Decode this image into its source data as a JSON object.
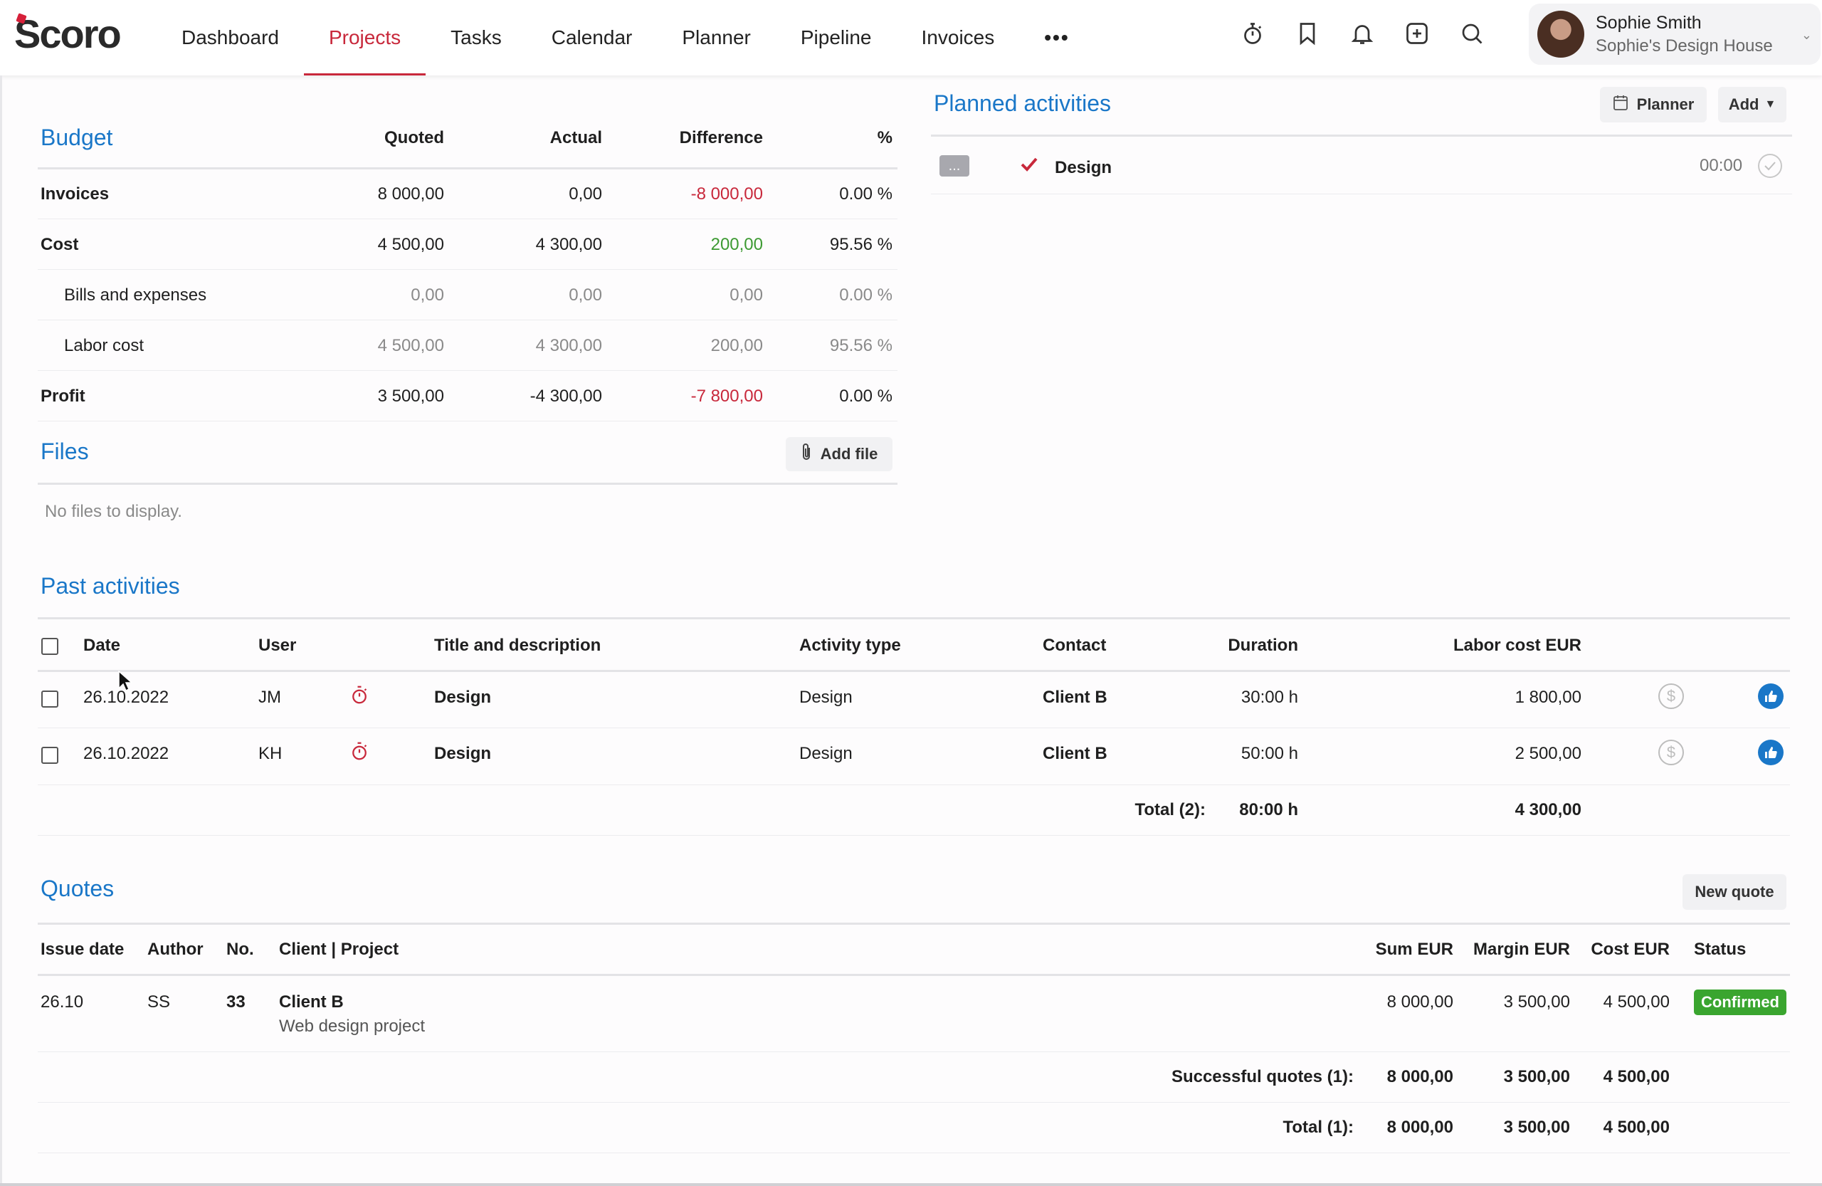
{
  "app": {
    "logo": "Scoro"
  },
  "nav": {
    "items": [
      "Dashboard",
      "Projects",
      "Tasks",
      "Calendar",
      "Planner",
      "Pipeline",
      "Invoices"
    ],
    "more": "•••"
  },
  "user": {
    "name": "Sophie Smith",
    "org": "Sophie's Design House"
  },
  "budget": {
    "title": "Budget",
    "headers": [
      "Quoted",
      "Actual",
      "Difference",
      "%"
    ],
    "rows": [
      {
        "label": "Invoices",
        "quoted": "8 000,00",
        "actual": "0,00",
        "difference": "-8 000,00",
        "pct": "0.00 %"
      },
      {
        "label": "Cost",
        "quoted": "4 500,00",
        "actual": "4 300,00",
        "difference": "200,00",
        "pct": "95.56 %"
      },
      {
        "label": "Bills and expenses",
        "quoted": "0,00",
        "actual": "0,00",
        "difference": "0,00",
        "pct": "0.00 %"
      },
      {
        "label": "Labor cost",
        "quoted": "4 500,00",
        "actual": "4 300,00",
        "difference": "200,00",
        "pct": "95.56 %"
      },
      {
        "label": "Profit",
        "quoted": "3 500,00",
        "actual": "-4 300,00",
        "difference": "-7 800,00",
        "pct": "0.00 %"
      }
    ]
  },
  "files": {
    "title": "Files",
    "add_label": "Add file",
    "empty": "No files to display."
  },
  "planned": {
    "title": "Planned activities",
    "planner_label": "Planner",
    "add_label": "Add",
    "item": {
      "menu": "...",
      "title": "Design",
      "time": "00:00"
    }
  },
  "past": {
    "title": "Past activities",
    "headers": {
      "date": "Date",
      "user": "User",
      "title": "Title and description",
      "type": "Activity type",
      "contact": "Contact",
      "duration": "Duration",
      "labor": "Labor cost EUR"
    },
    "rows": [
      {
        "date": "26.10.2022",
        "user": "JM",
        "title": "Design",
        "type": "Design",
        "contact": "Client B",
        "duration": "30:00 h",
        "labor": "1 800,00"
      },
      {
        "date": "26.10.2022",
        "user": "KH",
        "title": "Design",
        "type": "Design",
        "contact": "Client B",
        "duration": "50:00 h",
        "labor": "2 500,00"
      }
    ],
    "total": {
      "label": "Total (2):",
      "duration": "80:00 h",
      "labor": "4 300,00"
    }
  },
  "quotes": {
    "title": "Quotes",
    "new_label": "New quote",
    "headers": {
      "issue": "Issue date",
      "author": "Author",
      "no": "No.",
      "client": "Client | Project",
      "sum": "Sum EUR",
      "margin": "Margin EUR",
      "cost": "Cost EUR",
      "status": "Status"
    },
    "row": {
      "issue": "26.10",
      "author": "SS",
      "no": "33",
      "client": "Client B",
      "project": "Web design project",
      "sum": "8 000,00",
      "margin": "3 500,00",
      "cost": "4 500,00",
      "status": "Confirmed"
    },
    "successful": {
      "label": "Successful quotes (1):",
      "sum": "8 000,00",
      "margin": "3 500,00",
      "cost": "4 500,00"
    },
    "total": {
      "label": "Total (1):",
      "sum": "8 000,00",
      "margin": "3 500,00",
      "cost": "4 500,00"
    }
  },
  "colors": {
    "accent_red": "#c8283b",
    "link_blue": "#1a77c8",
    "positive_green": "#3d9a32",
    "status_green": "#3aa52f"
  }
}
